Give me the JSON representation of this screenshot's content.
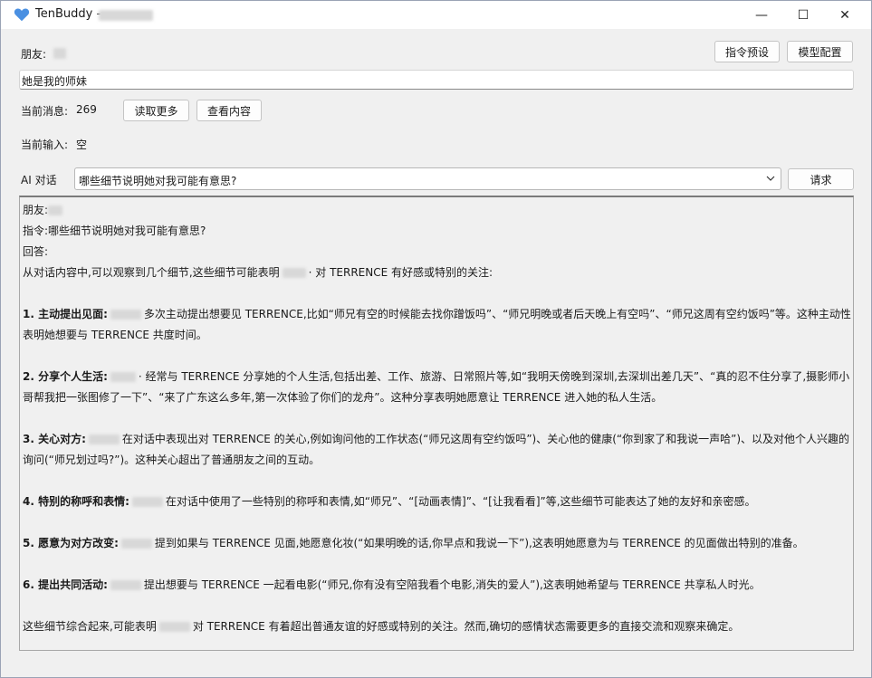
{
  "window": {
    "title": "TenBuddy - ",
    "minimize_glyph": "—",
    "maximize_glyph": "☐",
    "close_glyph": "✕"
  },
  "friend": {
    "label": "朋友:"
  },
  "buttons": {
    "instruction_preset": "指令预设",
    "model_config": "模型配置",
    "read_more": "读取更多",
    "view_content": "查看内容",
    "request": "请求"
  },
  "note_input": {
    "value": "她是我的师妹"
  },
  "status": {
    "current_messages_label": "当前消息:",
    "current_messages_count": "269",
    "current_input_label": "当前输入:",
    "current_input_value": "空"
  },
  "ai_chat": {
    "label": "AI 对话",
    "query": "哪些细节说明她对我可能有意思?"
  },
  "output": {
    "friend_label": "朋友:",
    "instruction_line": "指令:哪些细节说明她对我可能有意思?",
    "answer_label": "回答:",
    "intro_a": "从对话内容中,可以观察到几个细节,这些细节可能表明",
    "intro_b": "· 对 TERRENCE 有好感或特别的关注:",
    "points": [
      {
        "title": "1. 主动提出见面:",
        "text": "多次主动提出想要见 TERRENCE,比如“师兄有空的时候能去找你蹭饭吗”、“师兄明晚或者后天晚上有空吗”、“师兄这周有空约饭吗”等。这种主动性表明她想要与 TERRENCE 共度时间。"
      },
      {
        "title": "2. 分享个人生活:",
        "text": "· 经常与 TERRENCE 分享她的个人生活,包括出差、工作、旅游、日常照片等,如“我明天傍晚到深圳,去深圳出差几天”、“真的忍不住分享了,摄影师小哥帮我把一张图修了一下”、“来了广东这么多年,第一次体验了你们的龙舟”。这种分享表明她愿意让 TERRENCE 进入她的私人生活。"
      },
      {
        "title": "3. 关心对方:",
        "text": "在对话中表现出对 TERRENCE 的关心,例如询问他的工作状态(“师兄这周有空约饭吗”)、关心他的健康(“你到家了和我说一声哈”)、以及对他个人兴趣的询问(“师兄划过吗?”)。这种关心超出了普通朋友之间的互动。"
      },
      {
        "title": "4. 特别的称呼和表情:",
        "text": "在对话中使用了一些特别的称呼和表情,如“师兄”、“[动画表情]”、“[让我看看]”等,这些细节可能表达了她的友好和亲密感。"
      },
      {
        "title": "5. 愿意为对方改变:",
        "text": "提到如果与 TERRENCE 见面,她愿意化妆(“如果明晚的话,你早点和我说一下”),这表明她愿意为与 TERRENCE 的见面做出特别的准备。"
      },
      {
        "title": "6. 提出共同活动:",
        "text": "提出想要与 TERRENCE 一起看电影(“师兄,你有没有空陪我看个电影,消失的爱人”),这表明她希望与 TERRENCE 共享私人时光。"
      }
    ],
    "conclusion_a": "这些细节综合起来,可能表明",
    "conclusion_b": "对 TERRENCE 有着超出普通友谊的好感或特别的关注。然而,确切的感情状态需要更多的直接交流和观察来确定。"
  },
  "colors": {
    "app_icon": "#4a90e2",
    "background": "#f0f0f0",
    "titlebar": "#ffffff"
  }
}
